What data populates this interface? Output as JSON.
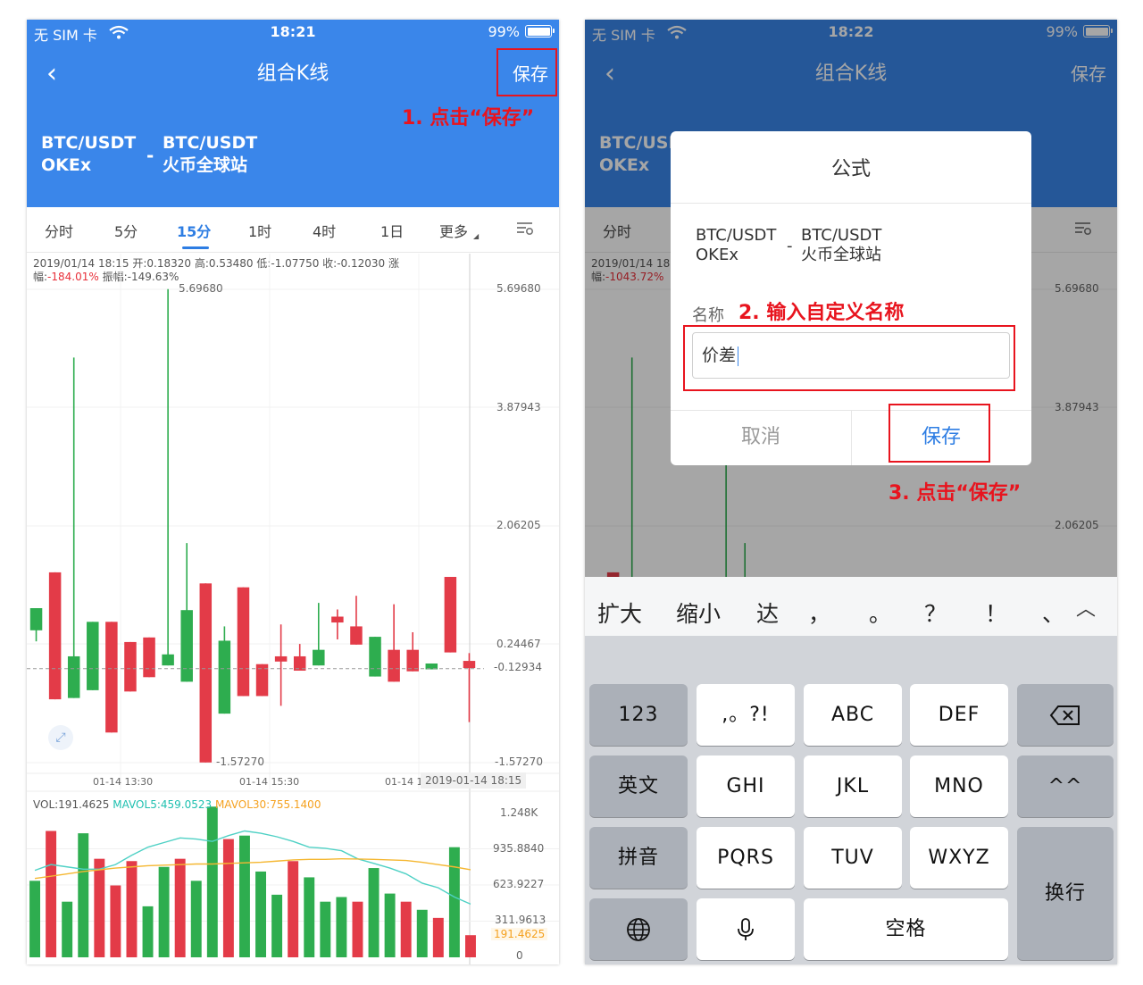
{
  "status_left": {
    "carrier": "无 SIM 卡",
    "time": "18:21",
    "battery": "99%"
  },
  "status_right": {
    "carrier": "无 SIM 卡",
    "time": "18:22",
    "battery": "99%"
  },
  "nav": {
    "title": "组合K线",
    "save": "保存"
  },
  "pair": {
    "left_symbol": "BTC/USDT",
    "left_exchange": "OKEx",
    "separator": "-",
    "right_symbol": "BTC/USDT",
    "right_exchange": "火币全球站"
  },
  "annotations": {
    "step1": "1. 点击“保存”",
    "step2": "2. 输入自定义名称",
    "step3": "3. 点击“保存”"
  },
  "tabs": [
    "分时",
    "5分",
    "15分",
    "1时",
    "4时",
    "1日",
    "更多"
  ],
  "active_tab": "15分",
  "info_left": {
    "prefix": "2019/01/14 18:15 开:0.18320 高:0.53480 低:-1.07750 收:-0.12030 涨幅:",
    "change": "-184.01%",
    "suffix": " 振幅:-149.63%"
  },
  "info_right": {
    "prefix": "2019/01/14 18",
    "change_label": "幅:",
    "change": "-1043.72%"
  },
  "chart_data": [
    {
      "type": "candlestick",
      "yaxis_labels": [
        "5.69680",
        "3.87943",
        "2.06205",
        "0.24467",
        "-0.12934",
        "-1.57270"
      ],
      "ylim": [
        -1.5727,
        5.6968
      ],
      "current_price": "-0.12934",
      "max_label": "5.69680",
      "min_label": "-1.57270",
      "xaxis_labels": [
        "01-14 13:30",
        "01-14 15:30",
        "01-14 1"
      ],
      "crosshair_time": "2019-01-14 18:15",
      "candles": [
        {
          "o": 0.8,
          "c": 0.46,
          "h": 0.8,
          "l": 0.29,
          "up": true
        },
        {
          "o": 1.35,
          "c": -0.6,
          "h": 1.35,
          "l": -0.6,
          "up": false
        },
        {
          "o": -0.58,
          "c": 0.06,
          "h": 4.65,
          "l": -0.58,
          "up": true
        },
        {
          "o": 0.59,
          "c": -0.46,
          "h": 0.59,
          "l": -0.46,
          "up": true
        },
        {
          "o": 0.59,
          "c": -1.11,
          "h": 0.59,
          "l": -1.11,
          "up": false
        },
        {
          "o": 0.28,
          "c": -0.48,
          "h": 0.28,
          "l": -0.48,
          "up": false
        },
        {
          "o": 0.35,
          "c": -0.26,
          "h": 0.35,
          "l": -0.26,
          "up": false
        },
        {
          "o": -0.08,
          "c": 0.09,
          "h": 5.7,
          "l": -0.08,
          "up": true
        },
        {
          "o": 0.77,
          "c": -0.33,
          "h": 1.8,
          "l": -0.33,
          "up": true
        },
        {
          "o": 1.18,
          "c": -1.57,
          "h": 1.18,
          "l": -1.57,
          "up": false
        },
        {
          "o": -0.82,
          "c": 0.3,
          "h": 0.52,
          "l": -0.82,
          "up": true
        },
        {
          "o": 1.12,
          "c": -0.55,
          "h": 1.12,
          "l": -0.55,
          "up": false
        },
        {
          "o": -0.06,
          "c": -0.55,
          "h": -0.06,
          "l": -0.55,
          "up": false
        },
        {
          "o": 0.06,
          "c": -0.02,
          "h": 0.55,
          "l": -0.7,
          "up": false
        },
        {
          "o": 0.06,
          "c": -0.16,
          "h": 0.25,
          "l": -0.16,
          "up": false
        },
        {
          "o": 0.16,
          "c": -0.08,
          "h": 0.88,
          "l": -0.08,
          "up": true
        },
        {
          "o": 0.67,
          "c": 0.58,
          "h": 0.78,
          "l": 0.32,
          "up": false
        },
        {
          "o": 0.52,
          "c": 0.24,
          "h": 0.99,
          "l": 0.24,
          "up": false
        },
        {
          "o": 0.36,
          "c": -0.25,
          "h": 0.36,
          "l": -0.25,
          "up": true
        },
        {
          "o": 0.16,
          "c": -0.33,
          "h": 0.86,
          "l": -0.33,
          "up": false
        },
        {
          "o": 0.16,
          "c": -0.17,
          "h": 0.43,
          "l": -0.17,
          "up": false
        },
        {
          "o": -0.14,
          "c": -0.05,
          "h": -0.05,
          "l": -0.14,
          "up": true
        },
        {
          "o": 1.28,
          "c": 0.12,
          "h": 1.28,
          "l": 0.12,
          "up": false
        },
        {
          "o": -0.01,
          "c": -0.12,
          "h": 0.11,
          "l": -0.95,
          "up": false
        }
      ]
    },
    {
      "type": "bar",
      "title": "VOL",
      "vol_label": "VOL:191.4625",
      "ma5_label": "MAVOL5:459.0523",
      "ma30_label": "MAVOL30:755.1400",
      "yaxis_labels": [
        "1.248K",
        "935.8840",
        "623.9227",
        "311.9613",
        "191.4625",
        "0"
      ],
      "ylim": [
        0,
        1248
      ],
      "values": [
        660,
        1090,
        480,
        1070,
        850,
        620,
        830,
        440,
        780,
        850,
        660,
        1300,
        1020,
        1050,
        740,
        540,
        830,
        690,
        480,
        520,
        480,
        770,
        550,
        480,
        410,
        340,
        950,
        191
      ],
      "up": [
        true,
        false,
        true,
        true,
        false,
        false,
        false,
        true,
        true,
        false,
        true,
        true,
        false,
        true,
        true,
        true,
        false,
        true,
        true,
        true,
        false,
        true,
        true,
        false,
        true,
        false,
        true,
        false
      ],
      "ma5": [
        750,
        800,
        780,
        760,
        760,
        800,
        880,
        950,
        990,
        1030,
        1020,
        1000,
        1050,
        1090,
        1070,
        1040,
        1000,
        950,
        940,
        920,
        850,
        810,
        770,
        720,
        640,
        600,
        520,
        459
      ],
      "ma30": [
        680,
        700,
        720,
        740,
        755,
        770,
        780,
        790,
        795,
        800,
        805,
        805,
        810,
        815,
        820,
        830,
        840,
        845,
        845,
        850,
        848,
        845,
        840,
        835,
        820,
        800,
        780,
        755
      ]
    }
  ],
  "dialog": {
    "title": "公式",
    "name_label": "名称",
    "name_value": "价差",
    "cancel": "取消",
    "save": "保存"
  },
  "keyboard": {
    "candidates": [
      "扩大",
      "缩小",
      "达",
      "，",
      "。",
      "？",
      "！",
      "、"
    ],
    "rows": [
      [
        "123",
        ",。?!",
        "ABC",
        "DEF"
      ],
      [
        "英文",
        "GHI",
        "JKL",
        "MNO",
        "^^"
      ],
      [
        "拼音",
        "PQRS",
        "TUV",
        "WXYZ"
      ],
      [
        "换行"
      ],
      [
        "空格"
      ]
    ]
  }
}
